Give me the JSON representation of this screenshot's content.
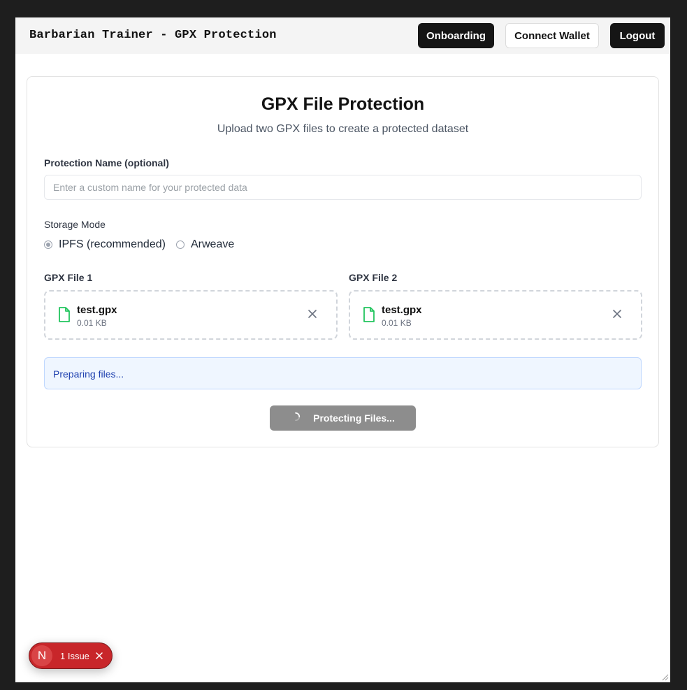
{
  "header": {
    "title": "Barbarian Trainer - GPX Protection",
    "onboarding_label": "Onboarding",
    "connect_wallet_label": "Connect Wallet",
    "logout_label": "Logout"
  },
  "card": {
    "title": "GPX File Protection",
    "subtitle": "Upload two GPX files to create a protected dataset"
  },
  "form": {
    "name_label": "Protection Name (optional)",
    "name_placeholder": "Enter a custom name for your protected data",
    "name_value": "",
    "storage_label": "Storage Mode",
    "storage_options": [
      {
        "label": "IPFS (recommended)",
        "selected": true
      },
      {
        "label": "Arweave",
        "selected": false
      }
    ]
  },
  "files": [
    {
      "label": "GPX File 1",
      "name": "test.gpx",
      "size": "0.01 KB"
    },
    {
      "label": "GPX File 2",
      "name": "test.gpx",
      "size": "0.01 KB"
    }
  ],
  "status": {
    "message": "Preparing files..."
  },
  "submit": {
    "label": "Protecting Files...",
    "disabled": true
  },
  "dev_overlay": {
    "badge_letter": "N",
    "issues_label": "1 Issue"
  },
  "colors": {
    "accent_dark": "#151515",
    "file_icon": "#22c55e",
    "status_bg": "#eff6ff",
    "status_text": "#1e40af",
    "issue_red": "#c8262a"
  }
}
